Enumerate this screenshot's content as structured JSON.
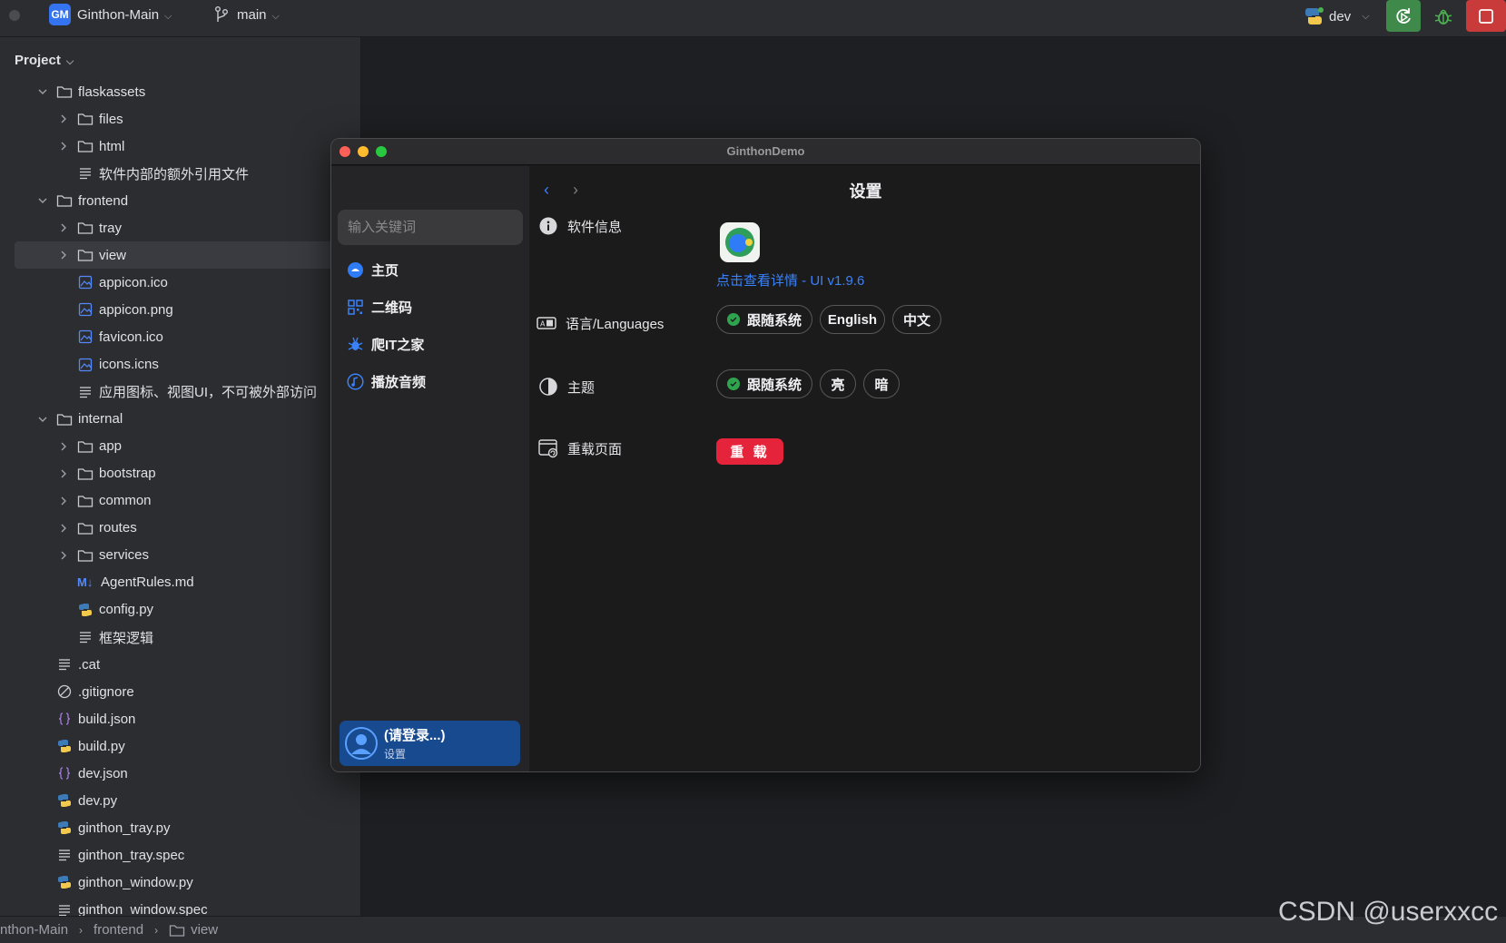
{
  "topbar": {
    "project_badge": "GM",
    "project_name": "Ginthon-Main",
    "branch": "main",
    "run_config": "dev"
  },
  "project_panel": {
    "title": "Project",
    "items": [
      {
        "label": "flaskassets",
        "type": "folder",
        "expanded": true
      },
      {
        "label": "files",
        "type": "folder"
      },
      {
        "label": "html",
        "type": "folder"
      },
      {
        "label": "软件内部的额外引用文件",
        "type": "text"
      },
      {
        "label": "frontend",
        "type": "folder",
        "expanded": true
      },
      {
        "label": "tray",
        "type": "folder"
      },
      {
        "label": "view",
        "type": "folder",
        "selected": true
      },
      {
        "label": "appicon.ico",
        "type": "image"
      },
      {
        "label": "appicon.png",
        "type": "image"
      },
      {
        "label": "favicon.ico",
        "type": "image"
      },
      {
        "label": "icons.icns",
        "type": "image"
      },
      {
        "label": "应用图标、视图UI，不可被外部访问",
        "type": "text"
      },
      {
        "label": "internal",
        "type": "folder",
        "expanded": true
      },
      {
        "label": "app",
        "type": "folder"
      },
      {
        "label": "bootstrap",
        "type": "folder"
      },
      {
        "label": "common",
        "type": "folder"
      },
      {
        "label": "routes",
        "type": "folder"
      },
      {
        "label": "services",
        "type": "folder"
      },
      {
        "label": "AgentRules.md",
        "type": "markdown",
        "badge": "M↓"
      },
      {
        "label": "config.py",
        "type": "python"
      },
      {
        "label": "框架逻辑",
        "type": "text"
      },
      {
        "label": ".cat",
        "type": "text"
      },
      {
        "label": ".gitignore",
        "type": "ignore"
      },
      {
        "label": "build.json",
        "type": "json"
      },
      {
        "label": "build.py",
        "type": "python"
      },
      {
        "label": "dev.json",
        "type": "json"
      },
      {
        "label": "dev.py",
        "type": "python"
      },
      {
        "label": "ginthon_tray.py",
        "type": "python"
      },
      {
        "label": "ginthon_tray.spec",
        "type": "text"
      },
      {
        "label": "ginthon_window.py",
        "type": "python"
      },
      {
        "label": "ginthon_window.spec",
        "type": "text"
      }
    ]
  },
  "statusbar": {
    "crumbs": [
      "nthon-Main",
      "frontend",
      "view"
    ]
  },
  "watermark": "CSDN @userxxcc",
  "demo_window": {
    "title": "GinthonDemo",
    "search_placeholder": "输入关键词",
    "nav": [
      {
        "label": "主页",
        "icon": "home-icon"
      },
      {
        "label": "二维码",
        "icon": "qrcode-icon"
      },
      {
        "label": "爬IT之家",
        "icon": "bug-icon"
      },
      {
        "label": "播放音频",
        "icon": "music-icon"
      }
    ],
    "user": {
      "name": "(请登录...)",
      "sub": "设置"
    },
    "page_title": "设置",
    "sections": {
      "info": {
        "label": "软件信息",
        "link": "点击查看详情 - UI v1.9.6"
      },
      "language": {
        "label": "语言/Languages",
        "options": [
          "跟随系统",
          "English",
          "中文"
        ],
        "selected": "跟随系统"
      },
      "theme": {
        "label": "主题",
        "options": [
          "跟随系统",
          "亮",
          "暗"
        ],
        "selected": "跟随系统"
      },
      "reload": {
        "label": "重载页面",
        "button": "重 载"
      }
    }
  },
  "colors": {
    "accent": "#3a82f7",
    "reload": "#e5243b",
    "check": "#2ea44f",
    "user_card": "#174a8f"
  }
}
